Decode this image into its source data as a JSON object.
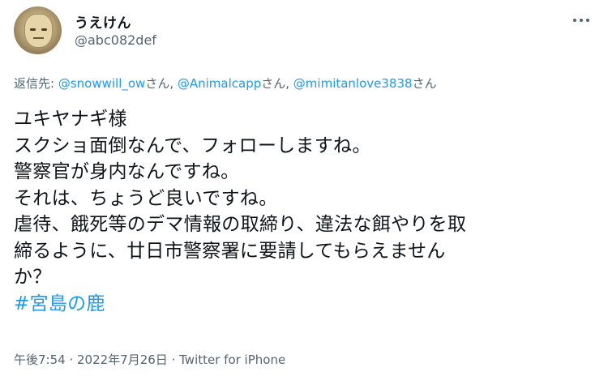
{
  "author": {
    "display_name": "うえけん",
    "handle": "@abc082def",
    "avatar_icon": "user-avatar-photo"
  },
  "more_icon": "more-horizontal-icon",
  "reply": {
    "prefix": "返信先: ",
    "mentions": [
      {
        "name": "@snowwill_ow",
        "suffix": "さん, "
      },
      {
        "name": "@Animalcapp",
        "suffix": "さん, "
      },
      {
        "name": "@mimitanlove3838",
        "suffix": "さん"
      }
    ]
  },
  "body": {
    "lines": [
      "ユキヤナギ様",
      "スクショ面倒なんで、フォローしますね。",
      "警察官が身内なんですね。",
      "それは、ちょうど良いですね。",
      "虐待、餓死等のデマ情報の取締り、違法な餌やりを取",
      "締るように、廿日市警察署に要請してもらえません",
      "か？"
    ],
    "hashtag": "#宮島の鹿"
  },
  "meta": {
    "time": "午後7:54",
    "separator": " · ",
    "date": "2022年7月26日",
    "source": "Twitter for iPhone"
  },
  "colors": {
    "link": "#1d9bf0",
    "secondary_text": "#536471",
    "primary_text": "#0f1419"
  }
}
